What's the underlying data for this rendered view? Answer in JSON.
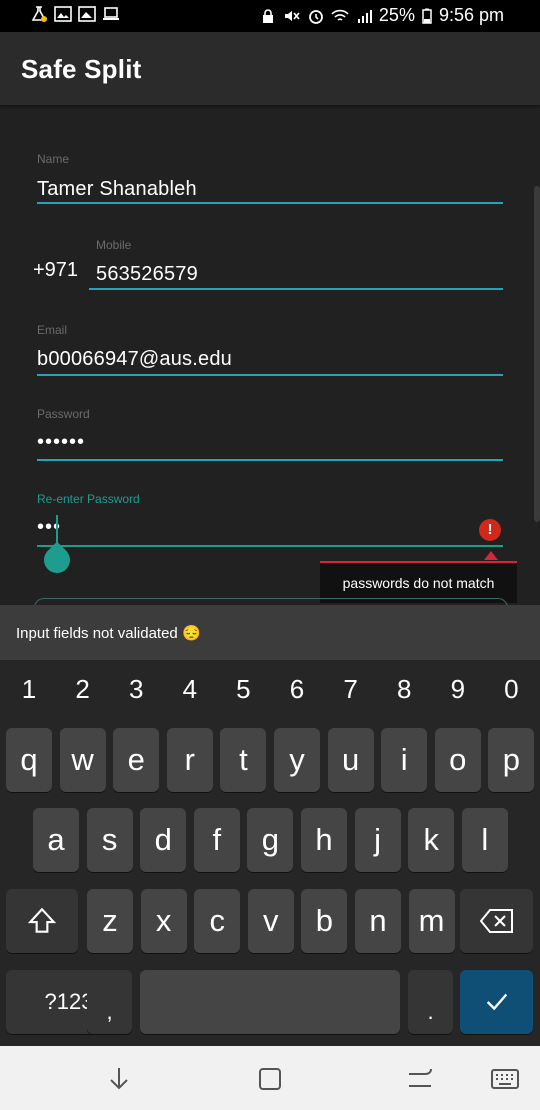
{
  "status_bar": {
    "battery": "25%",
    "time": "9:56 pm"
  },
  "app_bar": {
    "title": "Safe Split"
  },
  "form": {
    "name": {
      "label": "Name",
      "value": "Tamer Shanableh"
    },
    "mobile": {
      "prefix": "+971",
      "label": "Mobile",
      "value": "563526579"
    },
    "email": {
      "label": "Email",
      "value": "b00066947@aus.edu"
    },
    "password": {
      "label": "Password",
      "value": "••••••"
    },
    "reenter_password": {
      "label": "Re-enter Password",
      "value": "•••",
      "error_icon": "!",
      "error": "passwords do not match"
    }
  },
  "toast": {
    "text": "Input fields not validated 😔"
  },
  "keyboard": {
    "numbers": [
      "1",
      "2",
      "3",
      "4",
      "5",
      "6",
      "7",
      "8",
      "9",
      "0"
    ],
    "row1": [
      "q",
      "w",
      "e",
      "r",
      "t",
      "y",
      "u",
      "i",
      "o",
      "p"
    ],
    "row2": [
      "a",
      "s",
      "d",
      "f",
      "g",
      "h",
      "j",
      "k",
      "l"
    ],
    "row3": [
      "z",
      "x",
      "c",
      "v",
      "b",
      "n",
      "m"
    ],
    "symbols_key": "?123",
    "comma_key": ",",
    "period_key": ".",
    "shift_icon": "shift-icon",
    "backspace_icon": "backspace-icon",
    "enter_icon": "checkmark-icon",
    "enter_color": "#0f4f76"
  },
  "colors": {
    "accent": "#27a3b8",
    "focus": "#1e9d8f",
    "error": "#d0281b"
  }
}
